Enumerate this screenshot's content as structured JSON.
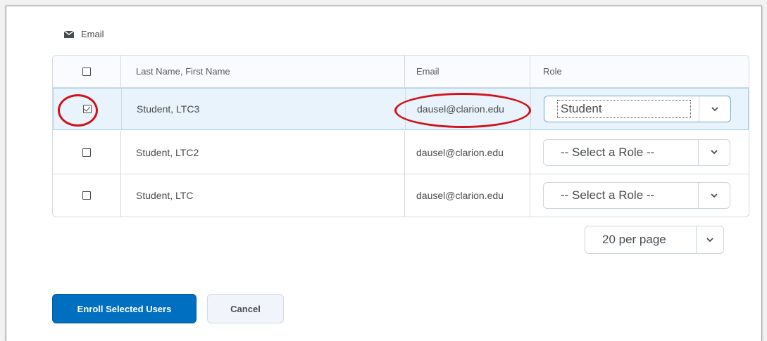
{
  "actions": {
    "email_label": "Email"
  },
  "table": {
    "headers": {
      "name": "Last Name, First Name",
      "email": "Email",
      "role": "Role"
    },
    "rows": [
      {
        "name": "Student, LTC3",
        "email": "dausel@clarion.edu",
        "role": "Student",
        "checked": true
      },
      {
        "name": "Student, LTC2",
        "email": "dausel@clarion.edu",
        "role": "-- Select a Role --",
        "checked": false
      },
      {
        "name": "Student, LTC",
        "email": "dausel@clarion.edu",
        "role": "-- Select a Role --",
        "checked": false
      }
    ]
  },
  "pagination": {
    "per_page": "20 per page"
  },
  "buttons": {
    "enroll": "Enroll Selected Users",
    "cancel": "Cancel"
  },
  "colors": {
    "primary": "#006fbf",
    "annotation": "#d2121b",
    "selected_row": "#e8f3fc"
  }
}
